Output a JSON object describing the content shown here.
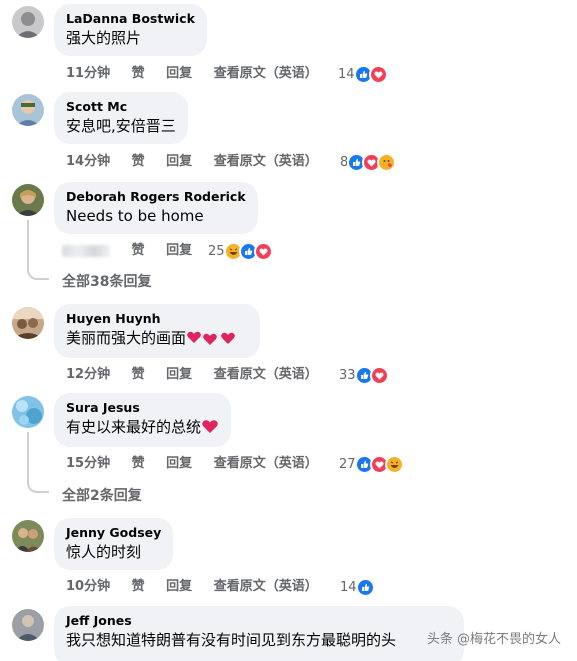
{
  "comments": [
    {
      "author": "LaDanna Bostwick",
      "text": "强大的照片",
      "time": "11分钟",
      "like": "赞",
      "reply": "回复",
      "translate": "查看原文（英语）",
      "reactions_count": "14",
      "reactions": [
        "like",
        "love"
      ]
    },
    {
      "author": "Scott Mc",
      "text": "安息吧,安倍晋三",
      "time": "14分钟",
      "like": "赞",
      "reply": "回复",
      "translate": "查看原文（英语）",
      "reactions_count": "8",
      "reactions": [
        "like",
        "love",
        "care"
      ]
    },
    {
      "author": "Deborah Rogers Roderick",
      "text": "Needs to be home",
      "time": "",
      "like": "赞",
      "reply": "回复",
      "translate": "",
      "reactions_count": "25",
      "reactions": [
        "haha",
        "like",
        "love"
      ],
      "view_replies": "全部38条回复"
    },
    {
      "author": "Huyen Huynh",
      "text": "美丽而强大的画面",
      "time": "12分钟",
      "like": "赞",
      "reply": "回复",
      "translate": "查看原文（英语）",
      "reactions_count": "33",
      "reactions": [
        "like",
        "love"
      ]
    },
    {
      "author": "Sura Jesus",
      "text": "有史以来最好的总统",
      "time": "15分钟",
      "like": "赞",
      "reply": "回复",
      "translate": "查看原文（英语）",
      "reactions_count": "27",
      "reactions": [
        "like",
        "love",
        "haha"
      ],
      "view_replies": "全部2条回复"
    },
    {
      "author": "Jenny Godsey",
      "text": "惊人的时刻",
      "time": "10分钟",
      "like": "赞",
      "reply": "回复",
      "translate": "查看原文（英语）",
      "reactions_count": "14",
      "reactions": [
        "like"
      ]
    },
    {
      "author": "Jeff Jones",
      "text": "我只想知道特朗普有没有时间见到东方最聪明的头",
      "time": "",
      "like": "",
      "reply": "",
      "translate": "",
      "reactions_count": "",
      "reactions": []
    }
  ],
  "watermark": "头条 @梅花不畏的女人",
  "colors": {
    "bubble": "#f0f2f5",
    "like": "#1877f2",
    "love": "#f33e58",
    "haha": "#f7b125",
    "meta": "#65676b"
  }
}
